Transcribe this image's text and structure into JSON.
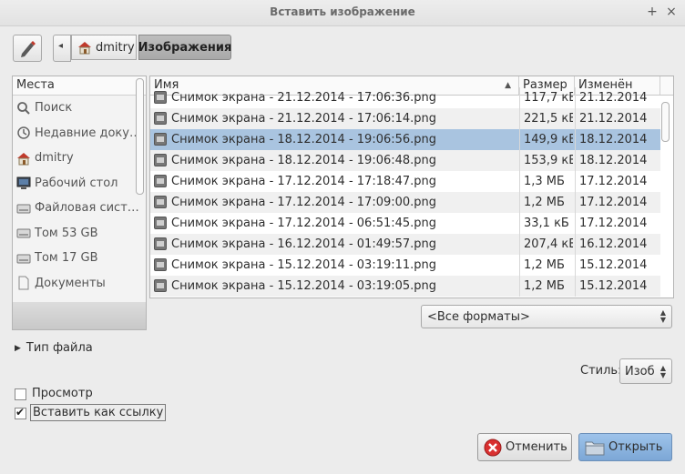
{
  "window": {
    "title": "Вставить изображение",
    "max_glyph": "+",
    "close_glyph": "×"
  },
  "icons": {
    "edit": "pencil-icon",
    "back": "arrow-left-icon",
    "home": "home-icon",
    "sort": "sort-up-icon",
    "expander": "triangle-right-icon",
    "check": "check-icon",
    "cancel": "cancel-icon",
    "open": "folder-icon"
  },
  "breadcrumb": {
    "back_glyph": "◂",
    "home_label": "dmitry",
    "current_label": "Изображения"
  },
  "places": {
    "header": "Места",
    "items": [
      {
        "label": "Поиск",
        "icon": "search-icon"
      },
      {
        "label": "Недавние доку…",
        "icon": "recent-icon"
      },
      {
        "label": "dmitry",
        "icon": "home-icon"
      },
      {
        "label": "Рабочий стол",
        "icon": "desktop-icon"
      },
      {
        "label": "Файловая сист…",
        "icon": "drive-icon"
      },
      {
        "label": "Том 53 GB",
        "icon": "drive-icon"
      },
      {
        "label": "Том 17 GB",
        "icon": "drive-icon"
      },
      {
        "label": "Документы",
        "icon": "document-icon"
      }
    ]
  },
  "files": {
    "columns": {
      "name": "Имя",
      "size": "Размер",
      "modified": "Изменён",
      "sort_glyph": "▲"
    },
    "rows": [
      {
        "name": "Снимок экрана - 21.12.2014 - 17:06:36.png",
        "size": "117,7 кБ",
        "date": "21.12.2014"
      },
      {
        "name": "Снимок экрана - 21.12.2014 - 17:06:14.png",
        "size": "221,5 кБ",
        "date": "21.12.2014"
      },
      {
        "name": "Снимок экрана - 18.12.2014 - 19:06:56.png",
        "size": "149,9 кБ",
        "date": "18.12.2014",
        "selected": true
      },
      {
        "name": "Снимок экрана - 18.12.2014 - 19:06:48.png",
        "size": "153,9 кБ",
        "date": "18.12.2014"
      },
      {
        "name": "Снимок экрана - 17.12.2014 - 17:18:47.png",
        "size": "1,3 МБ",
        "date": "17.12.2014"
      },
      {
        "name": "Снимок экрана - 17.12.2014 - 17:09:00.png",
        "size": "1,2 МБ",
        "date": "17.12.2014"
      },
      {
        "name": "Снимок экрана - 17.12.2014 - 06:51:45.png",
        "size": "33,1 кБ",
        "date": "17.12.2014"
      },
      {
        "name": "Снимок экрана - 16.12.2014 - 01:49:57.png",
        "size": "207,4 кБ",
        "date": "16.12.2014"
      },
      {
        "name": "Снимок экрана - 15.12.2014 - 03:19:11.png",
        "size": "1,2 МБ",
        "date": "15.12.2014"
      },
      {
        "name": "Снимок экрана - 15.12.2014 - 03:19:05.png",
        "size": "1,2 МБ",
        "date": "15.12.2014"
      }
    ]
  },
  "format_filter": {
    "value": "<Все форматы>",
    "spin_glyph": "▲▼"
  },
  "file_type": {
    "label": "Тип файла",
    "glyph": "▶"
  },
  "style": {
    "label": "Стиль:",
    "value": "Изоб"
  },
  "options": {
    "preview_label": "Просмотр",
    "preview_checked": false,
    "link_label": "Вставить как ссылку",
    "link_checked": true,
    "check_glyph": "✔"
  },
  "buttons": {
    "cancel": "Отменить",
    "open": "Открыть"
  },
  "colors": {
    "selection": "#a9c4e0",
    "open_button": "#8cb4e0",
    "cancel_red": "#d93030"
  }
}
